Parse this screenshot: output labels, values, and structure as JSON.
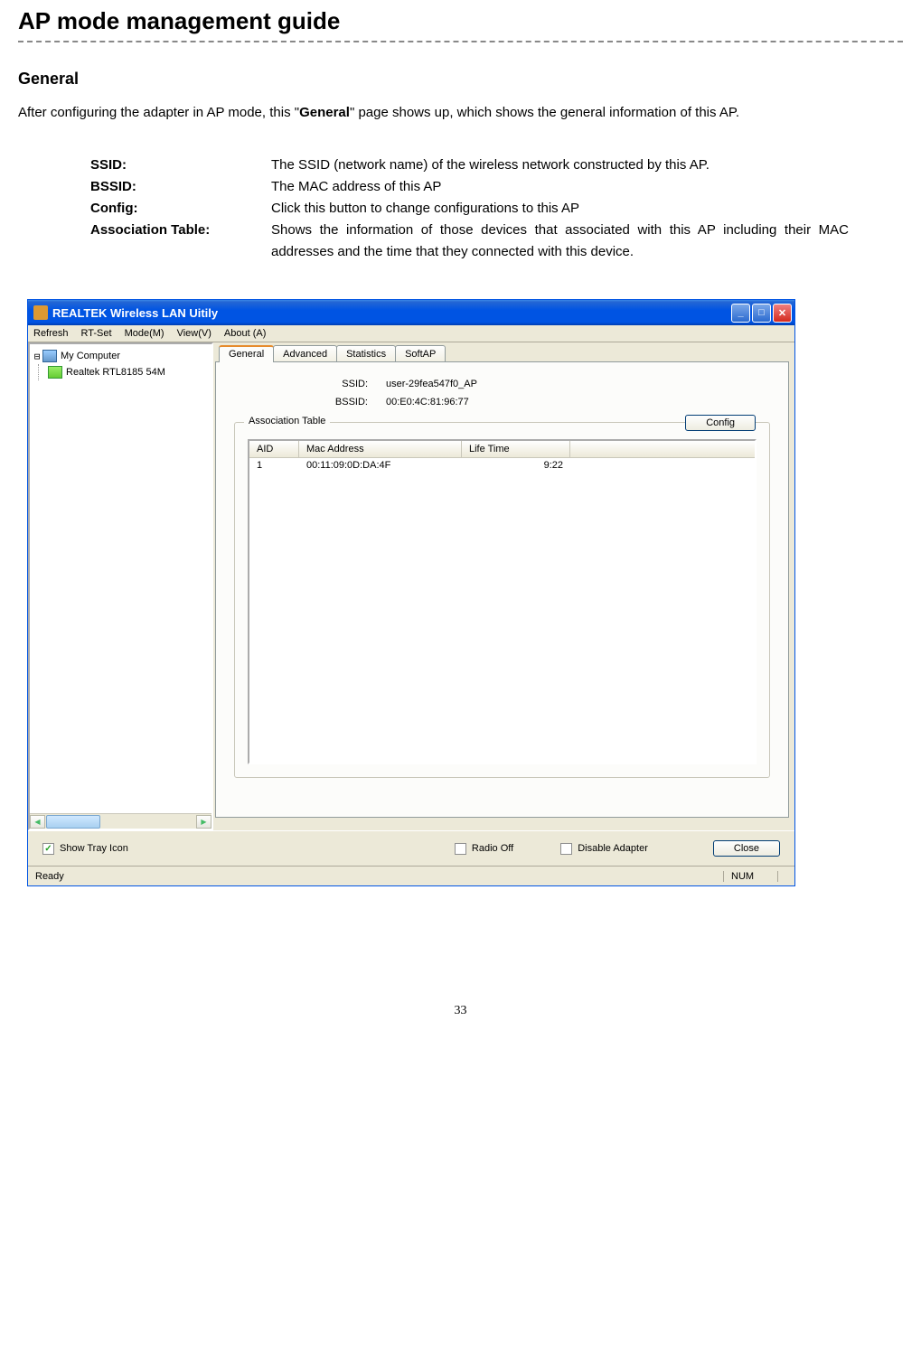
{
  "page": {
    "title": "AP mode management guide",
    "section_title": "General",
    "intro_pre": "After configuring the adapter in AP mode, this \"",
    "intro_bold": "General",
    "intro_post": "\" page shows up, which shows the general information of this AP.",
    "page_number": "33"
  },
  "definitions": [
    {
      "label": "SSID:",
      "value": "The SSID (network name) of the wireless network constructed by this AP."
    },
    {
      "label": "BSSID:",
      "value": "The MAC address of this AP"
    },
    {
      "label": "Config:",
      "value": "Click this button to change configurations to this AP"
    },
    {
      "label": "Association Table:",
      "value": "Shows the information of those devices that associated with this AP including their MAC addresses and the time that they connected with this device."
    }
  ],
  "app": {
    "title": "REALTEK Wireless LAN Uitily",
    "menu": {
      "refresh": "Refresh",
      "rtset": "RT-Set",
      "mode": "Mode(M)",
      "view": "View(V)",
      "about": "About (A)"
    },
    "tree": {
      "root": "My Computer",
      "child": "Realtek RTL8185 54M"
    },
    "tabs": {
      "general": "General",
      "advanced": "Advanced",
      "statistics": "Statistics",
      "softap": "SoftAP"
    },
    "fields": {
      "ssid_label": "SSID:",
      "ssid_value": "user-29fea547f0_AP",
      "bssid_label": "BSSID:",
      "bssid_value": "00:E0:4C:81:96:77"
    },
    "config_button": "Config",
    "assoc": {
      "title": "Association Table",
      "columns": {
        "aid": "AID",
        "mac": "Mac Address",
        "life": "Life Time"
      },
      "rows": [
        {
          "aid": "1",
          "mac": "00:11:09:0D:DA:4F",
          "life": "9:22"
        }
      ]
    },
    "bottom": {
      "show_tray": "Show Tray Icon",
      "radio_off": "Radio Off",
      "disable_adapter": "Disable Adapter",
      "close": "Close"
    },
    "status": {
      "ready": "Ready",
      "num": "NUM"
    }
  }
}
